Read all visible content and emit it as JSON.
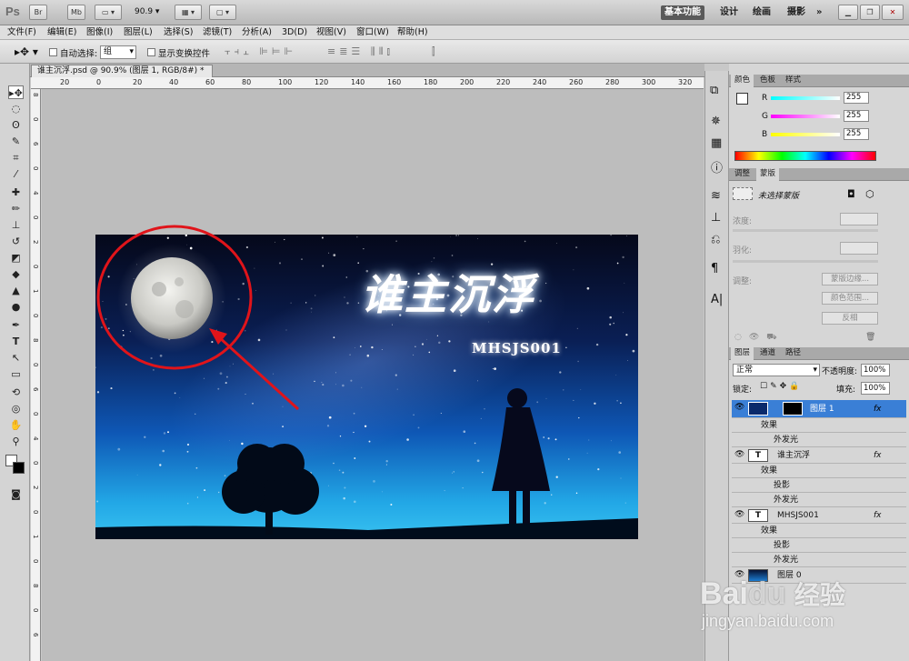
{
  "app": {
    "logo": "Ps",
    "zoom": "90.9",
    "workspace": {
      "active": "基本功能",
      "others": [
        "设计",
        "绘画",
        "摄影"
      ],
      "more": "»"
    },
    "top_buttons": [
      "Br",
      "Mb"
    ]
  },
  "menu": [
    "文件(F)",
    "编辑(E)",
    "图像(I)",
    "图层(L)",
    "选择(S)",
    "滤镜(T)",
    "分析(A)",
    "3D(D)",
    "视图(V)",
    "窗口(W)",
    "帮助(H)"
  ],
  "options": {
    "auto_select_label": "自动选择:",
    "auto_select_value": "组",
    "transform_label": "显示变换控件"
  },
  "document": {
    "tab_title": "谁主沉浮.psd @ 90.9% (图层 1, RGB/8#) *",
    "close": "×"
  },
  "ruler": {
    "h": [
      "20",
      "0",
      "20",
      "40",
      "60",
      "80",
      "100",
      "120",
      "140",
      "160",
      "180",
      "200",
      "220",
      "240",
      "260",
      "280",
      "300",
      "320"
    ],
    "v": [
      "8",
      "0",
      "6",
      "0",
      "4",
      "0",
      "2",
      "0",
      "1",
      "0",
      "8",
      "0",
      "6",
      "0",
      "4",
      "0",
      "2",
      "0",
      "1",
      "0",
      "8",
      "0",
      "6"
    ]
  },
  "image": {
    "title_text": "谁主沉浮",
    "sub_text": "MHSJS001"
  },
  "color_panel": {
    "tabs": [
      "颜色",
      "色板",
      "样式"
    ],
    "r_label": "R",
    "g_label": "G",
    "b_label": "B",
    "r": "255",
    "g": "255",
    "b": "255"
  },
  "mask_panel": {
    "tabs": [
      "调整",
      "蒙版"
    ],
    "status": "未选择蒙版",
    "density": "浓度:",
    "feather": "羽化:",
    "refine": "调整:",
    "buttons": [
      "蒙版边缘...",
      "颜色范围...",
      "反相"
    ]
  },
  "layers_panel": {
    "tabs": [
      "图层",
      "通道",
      "路径"
    ],
    "blend": "正常",
    "opacity_label": "不透明度:",
    "opacity": "100%",
    "lock_label": "锁定:",
    "fill_label": "填充:",
    "fill": "100%",
    "layers": [
      {
        "name": "图层 1",
        "fx": "fx"
      },
      {
        "name": "效果"
      },
      {
        "name": "外发光"
      },
      {
        "name": "谁主沉浮",
        "fx": "fx"
      },
      {
        "name": "效果"
      },
      {
        "name": "投影"
      },
      {
        "name": "外发光"
      },
      {
        "name": "MHSJS001",
        "fx": "fx"
      },
      {
        "name": "效果"
      },
      {
        "name": "投影"
      },
      {
        "name": "外发光"
      },
      {
        "name": "图层 0"
      }
    ]
  },
  "watermark": {
    "brand": "Bai",
    "paw": "du",
    "cn": "经验",
    "url": "jingyan.baidu.com"
  }
}
